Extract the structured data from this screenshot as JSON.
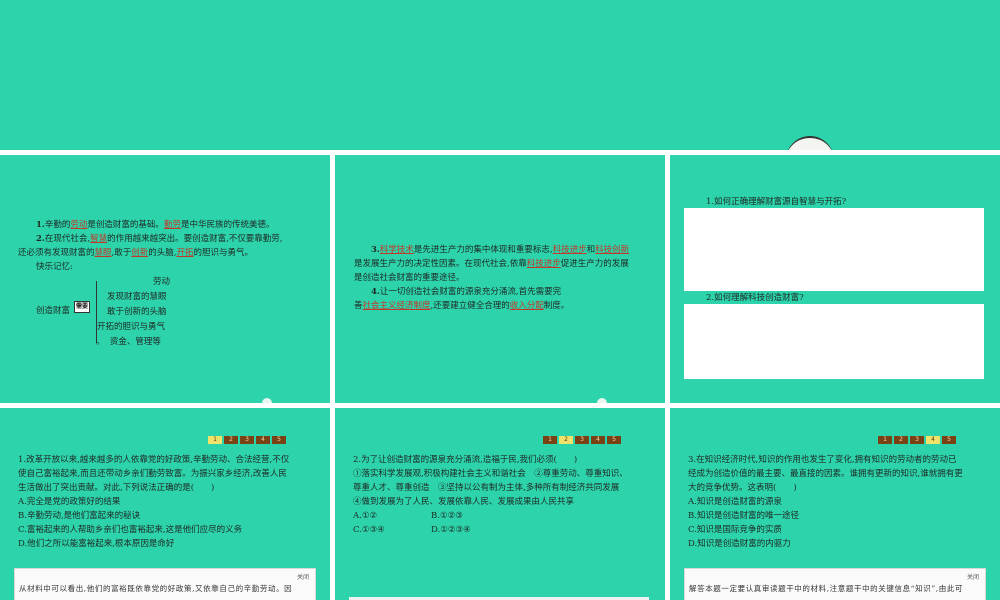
{
  "slide1": {
    "l1": {
      "a": "1.",
      "b": "辛勤的",
      "c": "劳动",
      "d": "是创造财富的基础。",
      "e": "勤劳",
      "f": "是中华民族的传统美德。"
    },
    "l2": {
      "a": "2.",
      "b": "在现代社会,",
      "c": "智慧",
      "d": "的作用越来越突出。要创造财富,不仅要靠勤劳,"
    },
    "l3": {
      "a": "还必须有发现财富的",
      "b": "慧眼",
      "c": ",敢于",
      "d": "创新",
      "e": "的头脑,",
      "f": "开拓",
      "g": "的胆识与勇气。"
    },
    "l4": "快乐记忆:",
    "mem_items": [
      "劳动",
      "发现财富的慧眼",
      "敢于创新的头脑",
      "开拓的胆识与勇气",
      "资金、管理等"
    ],
    "mem_root": "创造财富",
    "mem_need": "需要"
  },
  "slide2": {
    "l1": {
      "a": "3.",
      "b": "科学技术",
      "c": "是先进生产力的集中体现和重要标志,",
      "d": "科技进步",
      "e": "和",
      "f": "科技创新"
    },
    "l2": {
      "a": "是发展生产力的决定性因素。在现代社会,依靠",
      "b": "科技进步",
      "c": "促进生产力的发展"
    },
    "l3": "是创造社会财富的重要途径。",
    "l4": {
      "a": "4.",
      "b": "让一切创造社会财富的源泉充分涌流,首先需要完"
    },
    "l5": {
      "a": "善",
      "b": "社会主义经济制度",
      "c": ",还要建立健全合理的",
      "d": "收入分配",
      "e": "制度。"
    }
  },
  "slide3": {
    "q1": "1.如何正确理解财富源自智慧与开拓?",
    "q2": "2.如何理解科技创造财富?"
  },
  "pager": [
    "1",
    "2",
    "3",
    "4",
    "5"
  ],
  "slide4": {
    "lines": [
      "1.改革开放以来,越来越多的人依靠党的好政策,辛勤劳动、合法经营,不仅",
      "使自己富裕起来,而且还带动乡亲们勤劳致富。为振兴家乡经济,改善人民",
      "生活做出了突出贡献。对此,下列说法正确的是(　　)",
      "A.完全是党的政策好的结果",
      "B.辛勤劳动,是他们富起来的秘诀",
      "C.富裕起来的人帮助乡亲们也富裕起来,这是他们应尽的义务",
      "D.他们之所以能富裕起来,根本原因是命好"
    ],
    "ans_tag": "关闭",
    "ans_text": "从材料中可以看出,他们的富裕既依靠党的好政策,又依靠自己的辛勤劳动。因"
  },
  "slide5": {
    "lines": [
      "2.为了让创造财富的源泉充分涌流,造福于民,我们必须(　　)",
      "①落实科学发展观,积极构建社会主义和谐社会　②尊重劳动、尊重知识、",
      "尊重人才、尊重创造　③坚持以公有制为主体,多种所有制经济共同发展",
      "④做到发展为了人民、发展依靠人民、发展成果由人民共享"
    ],
    "optA": "A.①②",
    "optB": "B.①②③",
    "optC": "C.①③④",
    "optD": "D.①②③④"
  },
  "slide6": {
    "lines": [
      "3.在知识经济时代,知识的作用也发生了变化,拥有知识的劳动者的劳动已",
      "经成为创造价值的最主要、最直接的因素。谁拥有更新的知识,谁就拥有更",
      "大的竞争优势。这表明(　　)",
      "A.知识是创造财富的源泉",
      "B.知识是创造财富的唯一途径",
      "C.知识是国际竞争的实质",
      "D.知识是创造财富的内驱力"
    ],
    "ans_tag": "关闭",
    "ans_text": "解答本题一定要认真审读题干中的材料,注意题干中的关键信息“知识”,由此可"
  },
  "colors": {
    "slide_bg": "#2dd3aa",
    "highlight": "#c0392b",
    "pager_bg": "#7a4316",
    "pager_active": "#f1e36a"
  }
}
